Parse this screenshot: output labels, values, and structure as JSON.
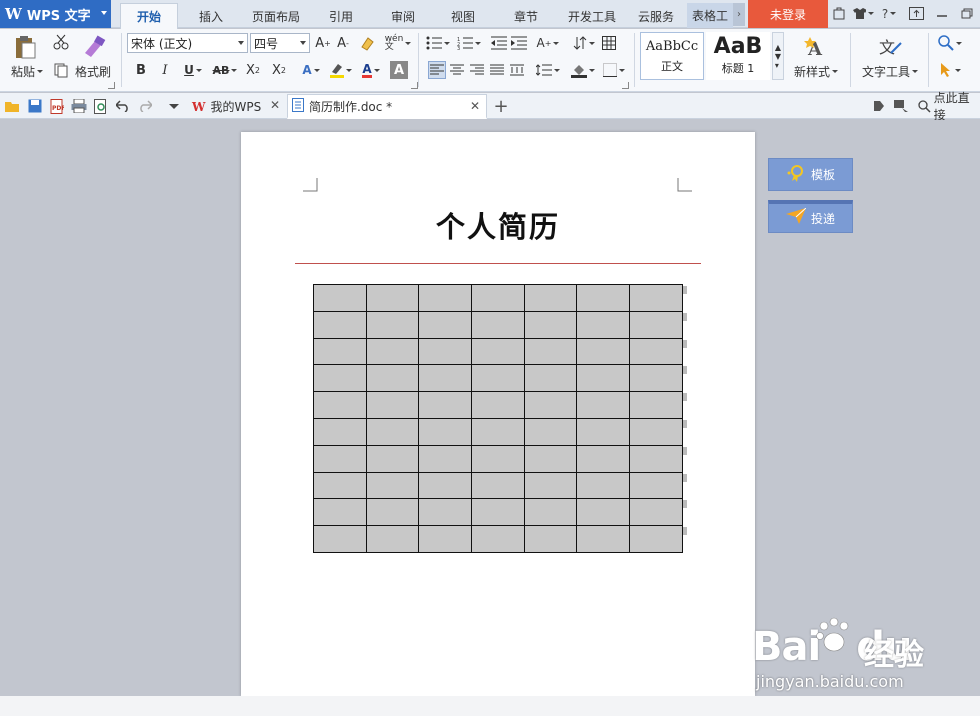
{
  "app": {
    "name": "WPS 文字",
    "login_label": "未登录"
  },
  "menu_tabs": [
    {
      "label": "开始"
    },
    {
      "label": "插入"
    },
    {
      "label": "页面布局"
    },
    {
      "label": "引用"
    },
    {
      "label": "审阅"
    },
    {
      "label": "视图"
    },
    {
      "label": "章节"
    },
    {
      "label": "开发工具"
    },
    {
      "label": "云服务"
    },
    {
      "label": "表格工"
    }
  ],
  "ribbon": {
    "paste_label": "粘贴",
    "format_painter_label": "格式刷",
    "font_name": "宋体 (正文)",
    "font_size": "四号",
    "style_normal_preview": "AaBbCc",
    "style_normal_label": "正文",
    "style_heading_preview": "AaB",
    "style_heading_label": "标题 1",
    "new_style_label": "新样式",
    "text_tools_label": "文字工具"
  },
  "doc_tabs": [
    {
      "label": "我的WPS"
    },
    {
      "label": "简历制作.doc *"
    }
  ],
  "find_label": "点此直接",
  "document": {
    "title": "个人简历",
    "table_rows": 10,
    "table_cols": 7
  },
  "side_buttons": {
    "template_label": "模板",
    "submit_label": "投递"
  },
  "watermark": {
    "logo": "Bai",
    "logo_suffix": "du",
    "cn": "经验",
    "url": "jingyan.baidu.com"
  }
}
